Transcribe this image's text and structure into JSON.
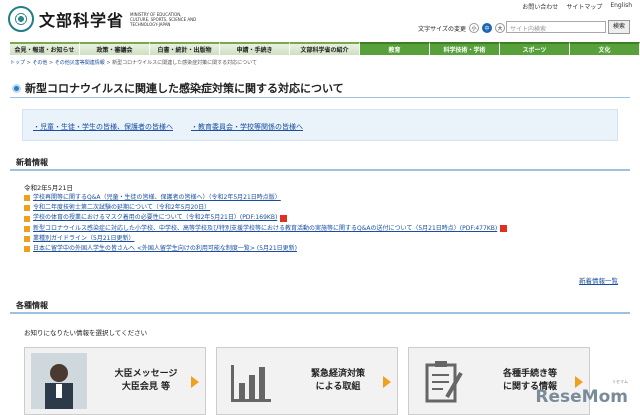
{
  "header": {
    "logo_title": "文部科学省",
    "logo_sub": "MINISTRY OF EDUCATION, CULTURE, SPORTS, SCIENCE AND TECHNOLOGY-JAPAN",
    "toplinks": [
      "お問い合わせ",
      "サイトマップ",
      "English"
    ],
    "font_size_label": "文字サイズの変更",
    "font_size_options": [
      "小",
      "中",
      "大"
    ],
    "search_placeholder": "サイト内検索",
    "search_button": "検索"
  },
  "nav": [
    "会見・報道・お知らせ",
    "政策・審議会",
    "白書・統計・出版物",
    "申請・手続き",
    "文部科学省の紹介",
    "教育",
    "科学技術・学術",
    "スポーツ",
    "文化"
  ],
  "breadcrumb": {
    "items": [
      "トップ",
      "その他",
      "その他災害等関連情報",
      "新型コロナウイルスに関連した感染症対策に関する対応について"
    ]
  },
  "page_title": "新型コロナウイルスに関連した感染症対策に関する対応について",
  "links": [
    "・児童・生徒・学生の皆様、保護者の皆様へ",
    "・教育委員会・学校等関係の皆様へ"
  ],
  "news": {
    "heading": "新着情報",
    "date": "令和2年5月21日",
    "items": [
      "学校再開等に関するQ&A（児童・生徒の皆様、保護者の皆様へ）（令和2年5月21日時点版）",
      "令和二年度技術士第二次試験の延期について（令和2年5月20日）",
      "学校の体育の授業におけるマスク着用の必要性について（令和2年5月21日）(PDF:169KB)",
      "新型コロナウイルス感染症に対応した小学校、中学校、高等学校及び特別支援学校等における教育活動の実施等に関するQ&Aの送付について（5月21日時点）(PDF:477KB)",
      "業種別ガイドライン（5月21日更新）",
      "日本に留学中の外国人学生の皆さんへ <外国人留学生向けの利用可能な制度一覧> (5月21日更新)"
    ],
    "pdf_flags": [
      false,
      false,
      true,
      true,
      false,
      false
    ],
    "more": "新着情報一覧"
  },
  "various": {
    "heading": "各種情報",
    "intro": "お知りになりたい情報を選択してください",
    "cards": [
      {
        "label1": "大臣メッセージ",
        "label2": "大臣会見 等",
        "icon": "minister-photo-icon"
      },
      {
        "label1": "緊急経済対策",
        "label2": "による取組",
        "icon": "bar-chart-icon"
      },
      {
        "label1": "各種手続き等",
        "label2": "に関する情報",
        "icon": "clipboard-pen-icon"
      }
    ]
  },
  "watermark": {
    "text": "ReseMom",
    "small": "リセマム"
  },
  "colors": {
    "accent_green": "#57a03a",
    "link_blue": "#1a4fa0",
    "bullet_orange": "#f0a020",
    "pdf_red": "#e0301e"
  }
}
